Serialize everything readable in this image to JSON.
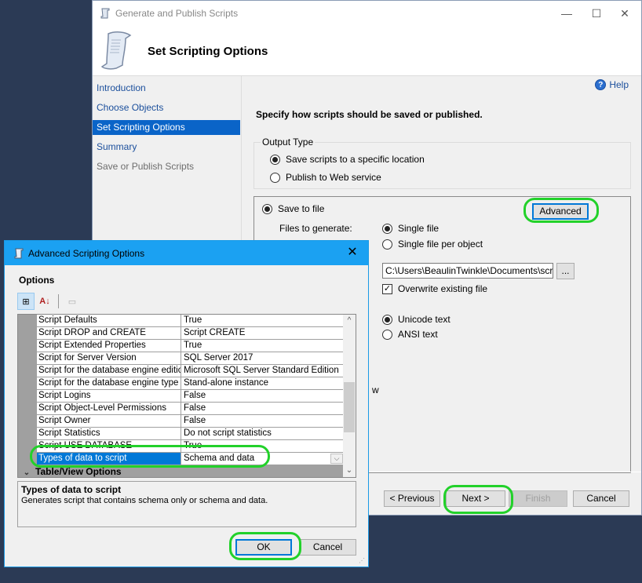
{
  "wizard": {
    "window_title": "Generate and Publish Scripts",
    "header_title": "Set Scripting Options",
    "controls": {
      "minimize": "—",
      "maximize": "☐",
      "close": "✕"
    },
    "nav": [
      {
        "label": "Introduction",
        "state": "link"
      },
      {
        "label": "Choose Objects",
        "state": "link"
      },
      {
        "label": "Set Scripting Options",
        "state": "active"
      },
      {
        "label": "Summary",
        "state": "link"
      },
      {
        "label": "Save or Publish Scripts",
        "state": "disabled"
      }
    ],
    "help_label": "Help",
    "help_icon": "?",
    "instruction": "Specify how scripts should be saved or published.",
    "output_type": {
      "title": "Output Type",
      "options": [
        {
          "label": "Save scripts to a specific location",
          "selected": true
        },
        {
          "label": "Publish to Web service",
          "selected": false
        }
      ]
    },
    "save_to_file_label": "Save to file",
    "advanced_label": "Advanced",
    "files_to_generate_label": "Files to generate:",
    "files_options": [
      {
        "label": "Single file",
        "selected": true
      },
      {
        "label": "Single file per object",
        "selected": false
      }
    ],
    "file_path": "C:\\Users\\BeaulinTwinkle\\Documents\\script.",
    "browse_label": "...",
    "overwrite_label": "Overwrite existing file",
    "overwrite_checked": true,
    "encoding_options": [
      {
        "label": "Unicode text",
        "selected": true
      },
      {
        "label": "ANSI text",
        "selected": false
      }
    ],
    "partial_text": "w",
    "buttons": {
      "previous": "< Previous",
      "next": "Next >",
      "finish": "Finish",
      "cancel": "Cancel"
    }
  },
  "advanced_dialog": {
    "title": "Advanced Scripting Options",
    "close": "✕",
    "options_label": "Options",
    "toolbar": {
      "categorized_icon": "⊞",
      "alphabetical_icon": "A↓",
      "property_pages_icon": "▭"
    },
    "properties": [
      {
        "name": "Script Defaults",
        "value": "True"
      },
      {
        "name": "Script DROP and CREATE",
        "value": "Script CREATE"
      },
      {
        "name": "Script Extended Properties",
        "value": "True"
      },
      {
        "name": "Script for Server Version",
        "value": "SQL Server 2017"
      },
      {
        "name": "Script for the database engine edition",
        "value": "Microsoft SQL Server Standard Edition"
      },
      {
        "name": "Script for the database engine type",
        "value": "Stand-alone instance"
      },
      {
        "name": "Script Logins",
        "value": "False"
      },
      {
        "name": "Script Object-Level Permissions",
        "value": "False"
      },
      {
        "name": "Script Owner",
        "value": "False"
      },
      {
        "name": "Script Statistics",
        "value": "Do not script statistics"
      },
      {
        "name": "Script USE DATABASE",
        "value": "True"
      },
      {
        "name": "Types of data to script",
        "value": "Schema and data",
        "selected": true
      }
    ],
    "category": "Table/View Options",
    "dropdown_glyph": "⌵",
    "scroll_up": "^",
    "scroll_down": "⌄",
    "description_title": "Types of data to script",
    "description_text": "Generates script that contains schema only or schema and data.",
    "ok_label": "OK",
    "cancel_label": "Cancel"
  },
  "colors": {
    "accent_blue": "#0078d7",
    "dialog_titlebar": "#1ba1f2",
    "highlight_green": "#22d12a",
    "nav_link": "#1b4f9c"
  }
}
